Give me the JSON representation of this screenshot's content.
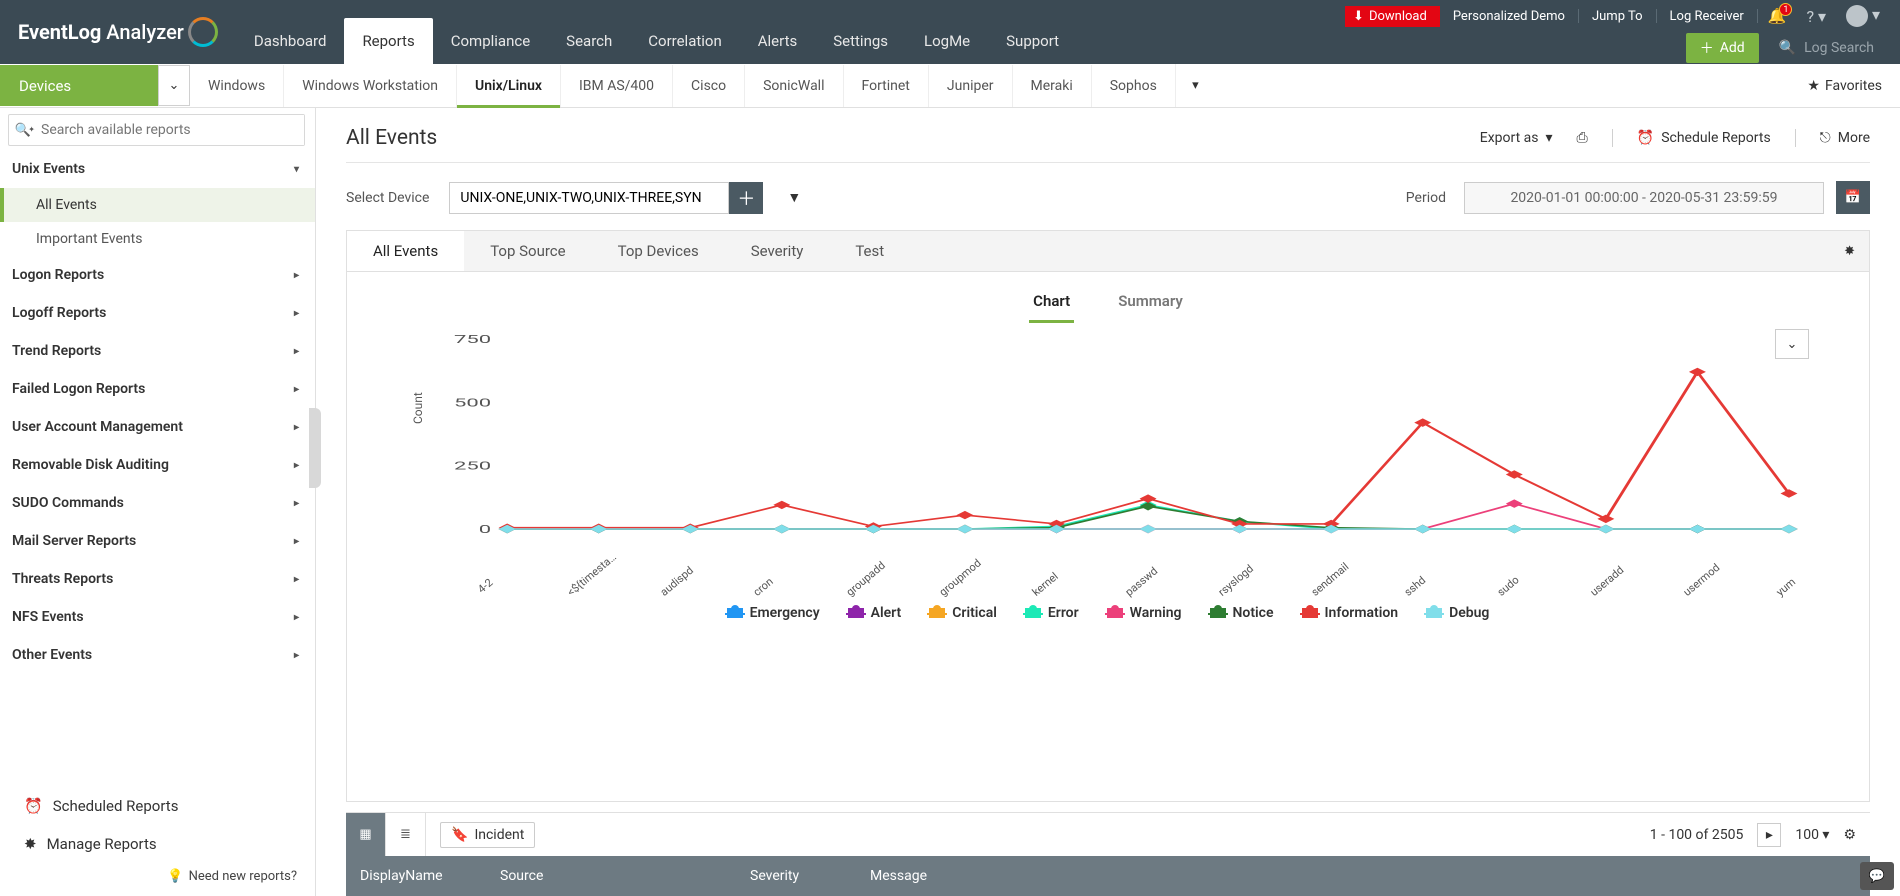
{
  "topbar": {
    "brand_a": "EventLog",
    "brand_b": "Analyzer",
    "tabs": [
      "Dashboard",
      "Reports",
      "Compliance",
      "Search",
      "Correlation",
      "Alerts",
      "Settings",
      "LogMe",
      "Support"
    ],
    "download": "Download",
    "mini": [
      "Personalized Demo",
      "Jump To",
      "Log Receiver"
    ],
    "bell_count": "1",
    "add_label": "Add",
    "log_search": "Log Search"
  },
  "subnav": {
    "devices": "Devices",
    "items": [
      "Windows",
      "Windows Workstation",
      "Unix/Linux",
      "IBM AS/400",
      "Cisco",
      "SonicWall",
      "Fortinet",
      "Juniper",
      "Meraki",
      "Sophos"
    ],
    "favorites": "Favorites"
  },
  "sidebar": {
    "search_placeholder": "Search available reports",
    "group_unix": "Unix Events",
    "sub_all": "All Events",
    "sub_imp": "Important Events",
    "groups": [
      "Logon Reports",
      "Logoff Reports",
      "Trend Reports",
      "Failed Logon Reports",
      "User Account Management",
      "Removable Disk Auditing",
      "SUDO Commands",
      "Mail Server Reports",
      "Threats Reports",
      "NFS Events",
      "Other Events"
    ],
    "scheduled": "Scheduled Reports",
    "manage": "Manage Reports",
    "need": "Need new reports?"
  },
  "page": {
    "title": "All Events",
    "export": "Export as",
    "schedule": "Schedule Reports",
    "more": "More",
    "select_device": "Select Device",
    "device_value": "UNIX-ONE,UNIX-TWO,UNIX-THREE,SYN",
    "period": "Period",
    "period_value": "2020-01-01 00:00:00 - 2020-05-31 23:59:59",
    "rtabs": [
      "All Events",
      "Top Source",
      "Top Devices",
      "Severity",
      "Test"
    ],
    "chart_tabs": [
      "Chart",
      "Summary"
    ],
    "ylabel": "Count"
  },
  "grid": {
    "incident": "Incident",
    "page_info": "1 - 100 of 2505",
    "page_size": "100",
    "columns": [
      "DisplayName",
      "Source",
      "Severity",
      "Message"
    ]
  },
  "chart_data": {
    "type": "line",
    "title": "",
    "ylabel": "Count",
    "ylim": [
      0,
      750
    ],
    "yticks": [
      0,
      250,
      500,
      750
    ],
    "categories": [
      "4-2",
      "<${timesta…",
      "audispd",
      "cron",
      "groupadd",
      "groupmod",
      "kernel",
      "passwd",
      "rsyslogd",
      "sendmail",
      "sshd",
      "sudo",
      "useradd",
      "usermod",
      "yum"
    ],
    "series": [
      {
        "name": "Emergency",
        "color": "#2196f3",
        "values": [
          0,
          0,
          0,
          0,
          0,
          0,
          0,
          0,
          0,
          0,
          0,
          0,
          0,
          0,
          0
        ]
      },
      {
        "name": "Alert",
        "color": "#8e24aa",
        "values": [
          0,
          0,
          0,
          0,
          0,
          0,
          0,
          0,
          0,
          0,
          0,
          0,
          0,
          0,
          0
        ]
      },
      {
        "name": "Critical",
        "color": "#f5a623",
        "values": [
          0,
          0,
          0,
          0,
          0,
          0,
          0,
          0,
          0,
          0,
          0,
          0,
          0,
          0,
          0
        ]
      },
      {
        "name": "Error",
        "color": "#1de9b6",
        "values": [
          0,
          0,
          0,
          0,
          0,
          0,
          10,
          95,
          30,
          0,
          0,
          0,
          0,
          0,
          0
        ]
      },
      {
        "name": "Warning",
        "color": "#ec407a",
        "values": [
          0,
          0,
          0,
          0,
          0,
          0,
          0,
          0,
          0,
          0,
          0,
          100,
          0,
          0,
          0
        ]
      },
      {
        "name": "Notice",
        "color": "#2e7d32",
        "values": [
          0,
          0,
          0,
          0,
          0,
          0,
          5,
          90,
          30,
          5,
          0,
          0,
          0,
          0,
          0
        ]
      },
      {
        "name": "Information",
        "color": "#e53935",
        "values": [
          5,
          5,
          5,
          95,
          10,
          55,
          20,
          120,
          20,
          20,
          420,
          215,
          40,
          620,
          140
        ]
      },
      {
        "name": "Debug",
        "color": "#80deea",
        "values": [
          0,
          0,
          0,
          0,
          0,
          0,
          0,
          0,
          0,
          0,
          0,
          0,
          0,
          0,
          0
        ]
      }
    ]
  }
}
